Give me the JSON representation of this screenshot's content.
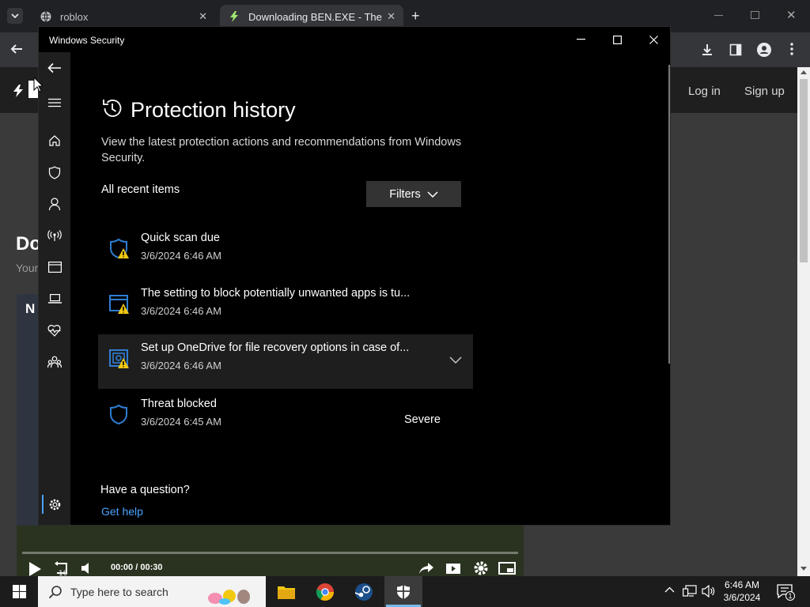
{
  "browser": {
    "tabs": [
      {
        "label": "roblox",
        "active": false
      },
      {
        "label": "Downloading BEN.EXE - The Co",
        "active": true
      }
    ],
    "site": {
      "login": "Log in",
      "signup": "Sign up",
      "heading_partial": "Do",
      "sub_partial": "Your",
      "thumb_partial": "N"
    },
    "video": {
      "time_current": "00:00",
      "time_sep": "/",
      "time_total": "00:30",
      "progress": 0
    }
  },
  "window": {
    "title": "Windows Security",
    "page_title": "Protection history",
    "description": "View the latest protection actions and recommendations from Windows Security.",
    "section_label": "All recent items",
    "filters_label": "Filters",
    "history": [
      {
        "title": "Quick scan due",
        "date": "3/6/2024 6:46 AM",
        "severity": "",
        "icon": "shield-warning-icon",
        "selected": false
      },
      {
        "title": "The setting to block potentially unwanted apps is tu...",
        "date": "3/6/2024 6:46 AM",
        "severity": "",
        "icon": "app-browser-warning-icon",
        "selected": false
      },
      {
        "title": "Set up OneDrive for file recovery options in case of...",
        "date": "3/6/2024 6:46 AM",
        "severity": "",
        "icon": "onedrive-warning-icon",
        "selected": true
      },
      {
        "title": "Threat blocked",
        "date": "3/6/2024 6:45 AM",
        "severity": "Severe",
        "icon": "shield-icon",
        "selected": false
      }
    ],
    "question": "Have a question?",
    "help_link": "Get help"
  },
  "taskbar": {
    "search_placeholder": "Type here to search",
    "time": "6:46 AM",
    "date": "3/6/2024",
    "notification_count": "1"
  },
  "colors": {
    "accent": "#4aa3ff",
    "warning": "#f2c811",
    "shield": "#2f7dd1"
  }
}
